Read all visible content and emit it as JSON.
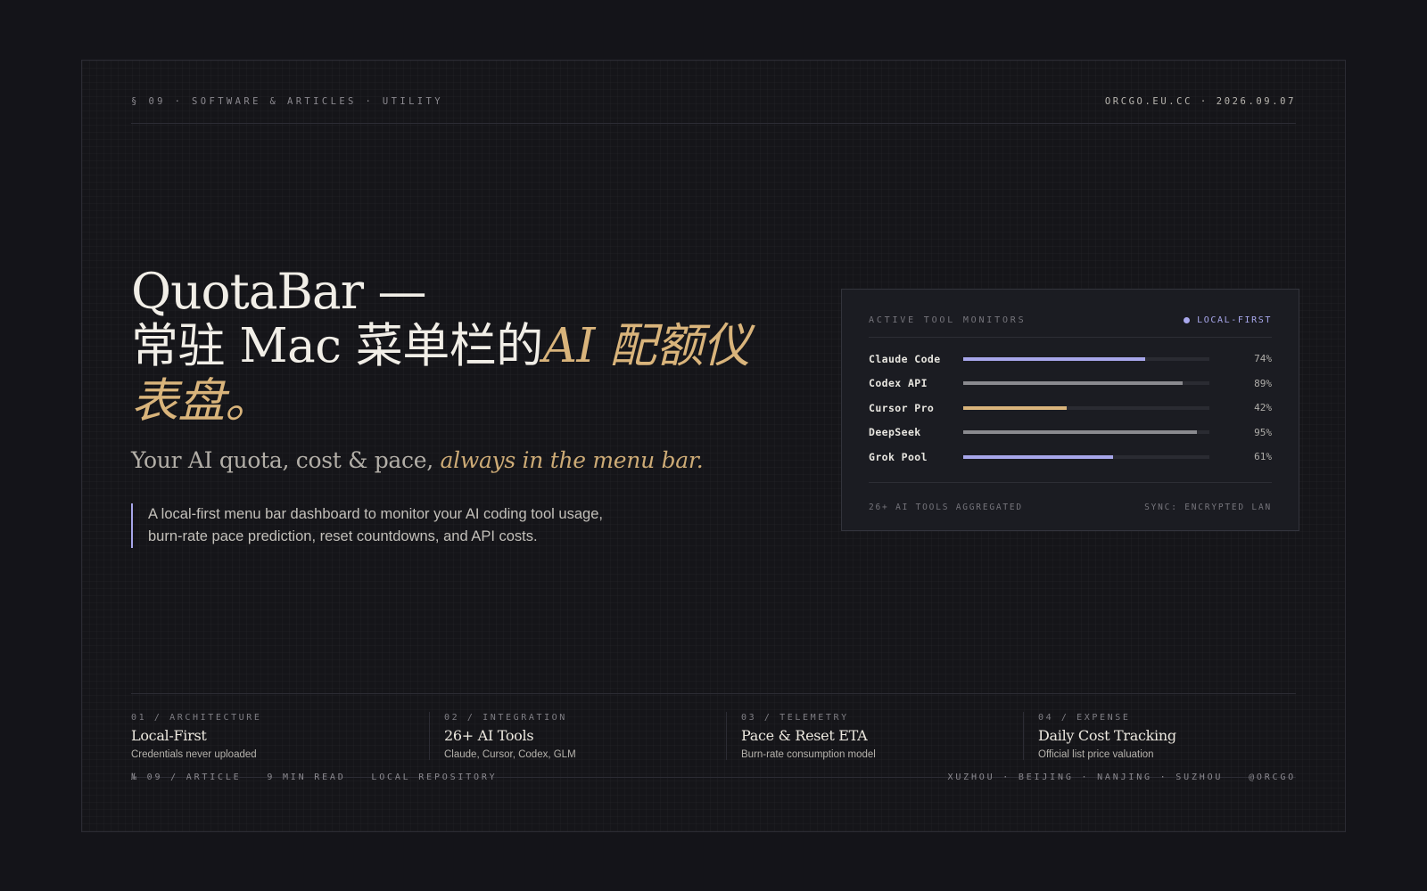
{
  "header": {
    "section": "§ 09 · SOFTWARE & ARTICLES · UTILITY",
    "site_date": "ORCGO.EU.CC · 2026.09.07"
  },
  "hero": {
    "title_line1": "QuotaBar —",
    "title_line2_plain": "常驻 Mac 菜单栏的",
    "title_line2_accent": "AI 配额仪表盘。",
    "subtitle_plain": "Your AI quota, cost & pace, ",
    "subtitle_accent": "always in the menu bar.",
    "description": "A local-first menu bar dashboard to monitor your AI coding tool usage, burn-rate pace prediction, reset countdowns, and API costs."
  },
  "monitor": {
    "title": "ACTIVE TOOL MONITORS",
    "badge": "LOCAL-FIRST",
    "rows": [
      {
        "label": "Claude Code",
        "percent": "74%",
        "value": 0.74,
        "color": "#a7a6ea"
      },
      {
        "label": "Codex API",
        "percent": "89%",
        "value": 0.89,
        "color": "#8a8a8f"
      },
      {
        "label": "Cursor Pro",
        "percent": "42%",
        "value": 0.42,
        "color": "#d9b47b"
      },
      {
        "label": "DeepSeek",
        "percent": "95%",
        "value": 0.95,
        "color": "#8a8a8f"
      },
      {
        "label": "Grok Pool",
        "percent": "61%",
        "value": 0.61,
        "color": "#a7a6ea"
      }
    ],
    "footer_left": "26+ AI TOOLS AGGREGATED",
    "footer_right": "SYNC: ENCRYPTED LAN"
  },
  "features": [
    {
      "num": "01 / ARCHITECTURE",
      "name": "Local-First",
      "sub": "Credentials never uploaded"
    },
    {
      "num": "02 / INTEGRATION",
      "name": "26+ AI Tools",
      "sub": "Claude, Cursor, Codex, GLM"
    },
    {
      "num": "03 / TELEMETRY",
      "name": "Pace & Reset ETA",
      "sub": "Burn-rate consumption model"
    },
    {
      "num": "04 / EXPENSE",
      "name": "Daily Cost Tracking",
      "sub": "Official list price valuation"
    }
  ],
  "footer": {
    "article": "№ 09 / ARTICLE",
    "read": "9 MIN READ",
    "repo": "LOCAL REPOSITORY",
    "cities": "XUZHOU · BEIJING · NANJING · SUZHOU",
    "handle": "@ORCGO"
  }
}
